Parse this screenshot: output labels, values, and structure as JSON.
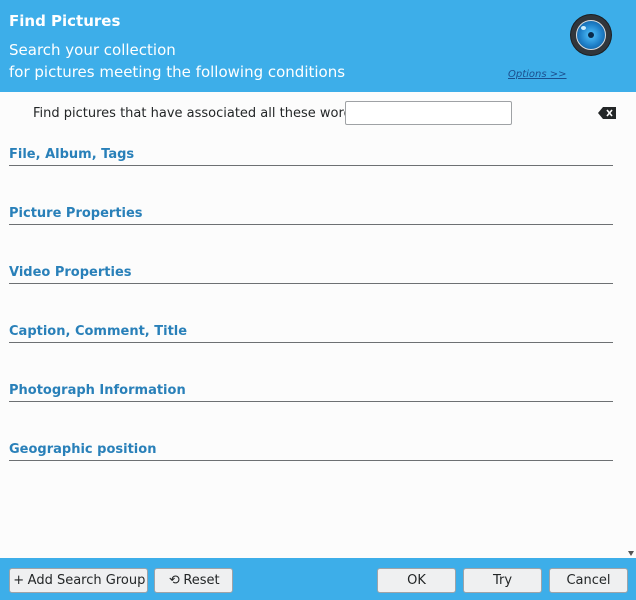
{
  "header": {
    "title": "Find Pictures",
    "subtitle_line1": "Search your collection",
    "subtitle_line2": "for pictures meeting the following conditions",
    "options_link": "Options >>"
  },
  "search": {
    "words_label": "Find pictures that have associated all these words:",
    "words_value": ""
  },
  "sections": [
    "File, Album, Tags",
    "Picture Properties",
    "Video Properties",
    "Caption, Comment, Title",
    "Photograph Information",
    "Geographic position"
  ],
  "buttons": {
    "add_group": "Add Search Group",
    "reset": "Reset",
    "ok": "OK",
    "try": "Try",
    "cancel": "Cancel"
  },
  "colors": {
    "accent": "#3daee9",
    "section_heading": "#2980b9"
  },
  "icons": {
    "app_logo": "camera-lens-logo",
    "clear": "clear-text-icon",
    "add": "plus-icon",
    "reset": "undo-icon",
    "scroll_down": "scroll-down-arrow-icon"
  }
}
